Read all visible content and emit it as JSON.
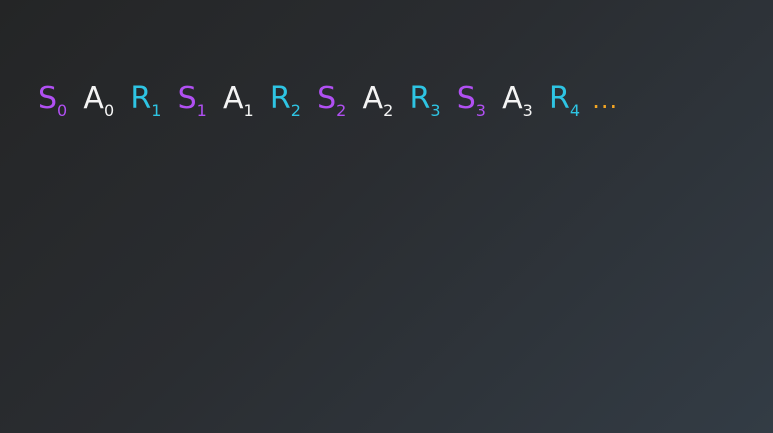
{
  "colors": {
    "state": "#b150f3",
    "action": "#f4f4f4",
    "reward": "#2ec4e3",
    "ellipsis": "#f5a623"
  },
  "sequence": [
    {
      "kind": "state",
      "letter": "S",
      "sub": "0"
    },
    {
      "kind": "action",
      "letter": "A",
      "sub": "0"
    },
    {
      "kind": "reward",
      "letter": "R",
      "sub": "1"
    },
    {
      "kind": "state",
      "letter": "S",
      "sub": "1"
    },
    {
      "kind": "action",
      "letter": "A",
      "sub": "1"
    },
    {
      "kind": "reward",
      "letter": "R",
      "sub": "2"
    },
    {
      "kind": "state",
      "letter": "S",
      "sub": "2"
    },
    {
      "kind": "action",
      "letter": "A",
      "sub": "2"
    },
    {
      "kind": "reward",
      "letter": "R",
      "sub": "3"
    },
    {
      "kind": "state",
      "letter": "S",
      "sub": "3"
    },
    {
      "kind": "action",
      "letter": "A",
      "sub": "3"
    },
    {
      "kind": "reward",
      "letter": "R",
      "sub": "4"
    }
  ],
  "ellipsis": "..."
}
